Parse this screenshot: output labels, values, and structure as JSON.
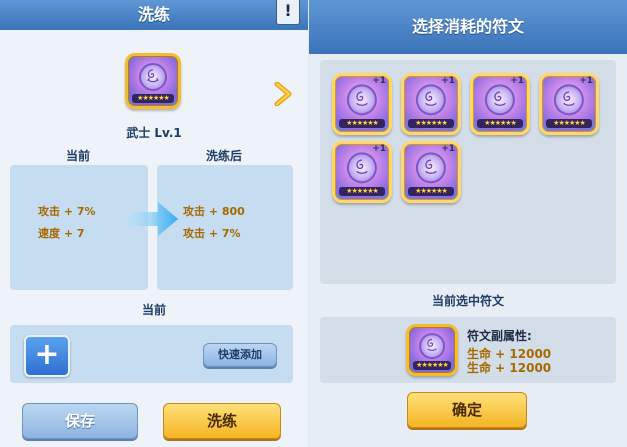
{
  "left": {
    "title": "洗练",
    "bookmark_icon": "!",
    "rune": {
      "stars": "★★★★★★",
      "level_name": "武士 Lv.1"
    },
    "current_label": "当前",
    "after_label": "洗练后",
    "current_stats": [
      "攻击 + 7%",
      "速度 + 7"
    ],
    "after_stats": [
      "攻击 + 800",
      "攻击 + 7%"
    ],
    "bottom_current_label": "当前",
    "add_button": "+",
    "quick_add": "快速添加",
    "save": "保存",
    "refine": "洗练"
  },
  "right": {
    "title": "选择消耗的符文",
    "runes": [
      {
        "plus": "+1",
        "stars": "★★★★★★"
      },
      {
        "plus": "+1",
        "stars": "★★★★★★"
      },
      {
        "plus": "+1",
        "stars": "★★★★★★"
      },
      {
        "plus": "+1",
        "stars": "★★★★★★"
      },
      {
        "plus": "+1",
        "stars": "★★★★★★"
      },
      {
        "plus": "+1",
        "stars": "★★★★★★"
      }
    ],
    "selected_label": "当前选中符文",
    "selected_rune": {
      "stars": "★★★★★★"
    },
    "sub_attr_label": "符文副属性:",
    "sub_attrs": [
      "生命 + 12000",
      "生命 + 12000"
    ],
    "confirm": "确定"
  },
  "colors": {
    "header": "#3a73b8",
    "gold": "#f4b523",
    "stat_text": "#a56a00"
  }
}
